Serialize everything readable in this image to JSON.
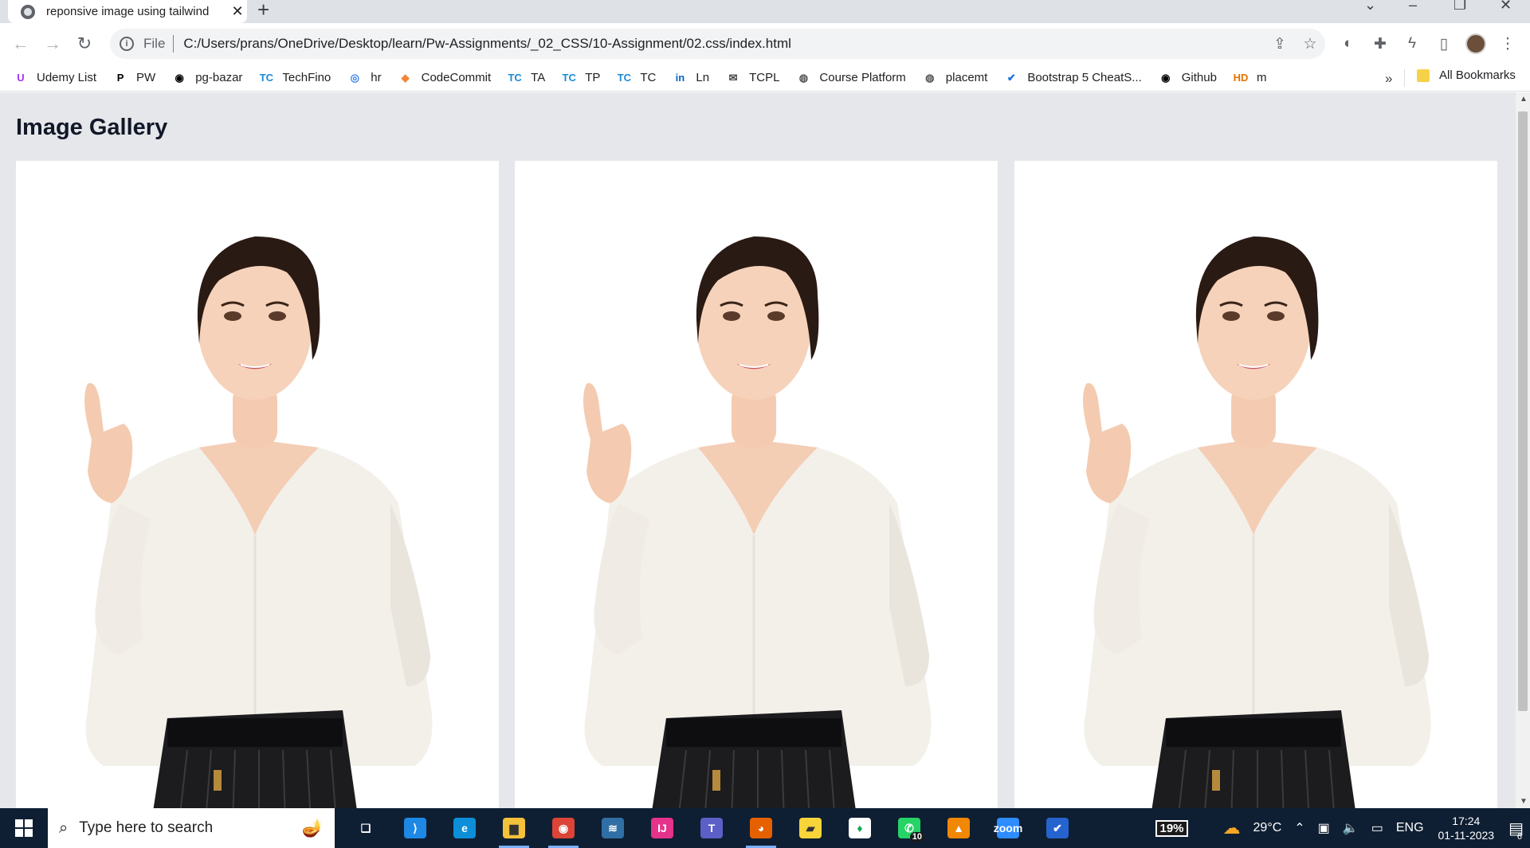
{
  "browser": {
    "tab_title": "reponsive image using tailwind",
    "tab_close": "✕",
    "new_tab": "+",
    "url_scheme": "File",
    "url": "C:/Users/prans/OneDrive/Desktop/learn/Pw-Assignments/_02_CSS/10-Assignment/02.css/index.html"
  },
  "bookmarks": {
    "items": [
      {
        "label": "Udemy List",
        "icon": "udemy-icon",
        "color": "#a435f0",
        "glyph": "U"
      },
      {
        "label": "PW",
        "icon": "pw-icon",
        "color": "#000000",
        "glyph": "P"
      },
      {
        "label": "pg-bazar",
        "icon": "github-icon",
        "color": "#000000",
        "glyph": "◉"
      },
      {
        "label": "TechFino",
        "icon": "tc-icon",
        "color": "#1a8ad4",
        "glyph": "TC"
      },
      {
        "label": "hr",
        "icon": "hr-icon",
        "color": "#3b82f6",
        "glyph": "◎"
      },
      {
        "label": "CodeCommit",
        "icon": "codecommit-icon",
        "color": "#f58536",
        "glyph": "◆"
      },
      {
        "label": "TA",
        "icon": "tc-icon",
        "color": "#1a8ad4",
        "glyph": "TC"
      },
      {
        "label": "TP",
        "icon": "tc-icon",
        "color": "#1a8ad4",
        "glyph": "TC"
      },
      {
        "label": "TC",
        "icon": "tc-icon",
        "color": "#1a8ad4",
        "glyph": "TC"
      },
      {
        "label": "Ln",
        "icon": "linkedin-icon",
        "color": "#0a66c2",
        "glyph": "in"
      },
      {
        "label": "TCPL",
        "icon": "mail-icon",
        "color": "#444444",
        "glyph": "✉"
      },
      {
        "label": "Course Platform",
        "icon": "globe-icon",
        "color": "#555555",
        "glyph": "◍"
      },
      {
        "label": "placemt",
        "icon": "globe-icon",
        "color": "#555555",
        "glyph": "◍"
      },
      {
        "label": "Bootstrap 5 CheatS...",
        "icon": "check-icon",
        "color": "#1a73e8",
        "glyph": "✔"
      },
      {
        "label": "Github",
        "icon": "github-icon",
        "color": "#000000",
        "glyph": "◉"
      },
      {
        "label": "m",
        "icon": "hd-icon",
        "color": "#e37400",
        "glyph": "HD"
      }
    ],
    "more": "»",
    "all_bookmarks": "All Bookmarks"
  },
  "page": {
    "heading": "Image Gallery",
    "images": [
      {
        "alt": "woman-pointing-up"
      },
      {
        "alt": "woman-pointing-up"
      },
      {
        "alt": "woman-pointing-up"
      }
    ]
  },
  "taskbar": {
    "search_placeholder": "Type here to search",
    "apps": [
      {
        "name": "task-view-icon",
        "glyph": "❏",
        "bg": "transparent",
        "active": false
      },
      {
        "name": "vscode-icon",
        "glyph": "⟩",
        "bg": "#1e88e5",
        "active": false
      },
      {
        "name": "edge-icon",
        "glyph": "e",
        "bg": "#0c8ed9",
        "active": false
      },
      {
        "name": "file-explorer-icon",
        "glyph": "▆",
        "bg": "#f4c13b",
        "active": true
      },
      {
        "name": "chrome-icon",
        "glyph": "◉",
        "bg": "#db4437",
        "active": true
      },
      {
        "name": "mysql-workbench-icon",
        "glyph": "≋",
        "bg": "#2f6fa5",
        "active": false
      },
      {
        "name": "intellij-icon",
        "glyph": "IJ",
        "bg": "#e5328a",
        "active": false
      },
      {
        "name": "teams-icon",
        "glyph": "T",
        "bg": "#5b5fc7",
        "active": false
      },
      {
        "name": "firefox-icon",
        "glyph": "◕",
        "bg": "#e66000",
        "active": true
      },
      {
        "name": "sticky-notes-icon",
        "glyph": "▰",
        "bg": "#f7d53a",
        "active": false
      },
      {
        "name": "mongodb-compass-icon",
        "glyph": "♦",
        "bg": "#ffffff",
        "active": false
      },
      {
        "name": "whatsapp-icon",
        "glyph": "✆",
        "bg": "#25d366",
        "active": false,
        "badge": "10"
      },
      {
        "name": "draw-icon",
        "glyph": "▲",
        "bg": "#f08705",
        "active": false
      },
      {
        "name": "zoom-icon",
        "glyph": "zoom",
        "bg": "#2d8cff",
        "active": false
      },
      {
        "name": "todo-icon",
        "glyph": "✔",
        "bg": "#2564cf",
        "active": false
      }
    ],
    "battery": "19%",
    "weather": "29°C",
    "language": "ENG",
    "time": "17:24",
    "date": "01-11-2023",
    "notification_count": "6"
  }
}
